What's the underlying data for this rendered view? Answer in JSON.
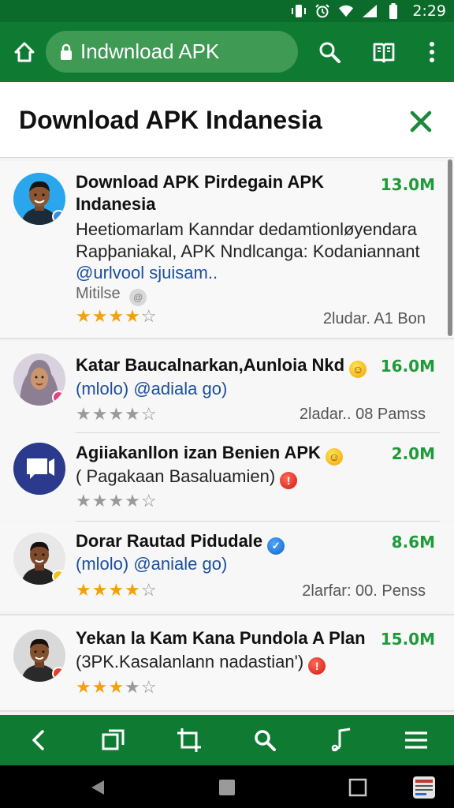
{
  "status_bar": {
    "time": "2:29"
  },
  "browser": {
    "url_text": "Indwnload APK"
  },
  "header": {
    "title": "Download APK Indanesia"
  },
  "apps": [
    {
      "title_line1": "Download APK Pirdegain APK",
      "title_line2": "Indanesia",
      "size": "13.0M",
      "desc_line1": "Heetiomarlam Kanndar dedamtionløyendara",
      "desc_line2": "Rapþaniakal, APK Nndlcanga: Kodaniannant",
      "link": "@urlvool sjuisam..",
      "meta": "Mitilse",
      "rating": 4,
      "info": "2ludar. A1 Bon"
    },
    {
      "title": "Katar Baucalnarkan,Aunloia Nkd",
      "size": "16.0M",
      "subtitle": "(mlolo) @adiala go)",
      "rating": 4,
      "info": "2ladar.. 08 Pamss"
    },
    {
      "title": "Agiiakanllon izan Benien APK",
      "size": "2.0M",
      "subtitle": "( Pagakaan Basaluamien)",
      "rating": 4
    },
    {
      "title": "Dorar Rautad Pidudale",
      "size": "8.6M",
      "subtitle": "(mlolo) @aniale go)",
      "rating": 4,
      "info": "2larfar: 00. Penss"
    },
    {
      "title": "Yekan la Kam Kana Pundola A Plan",
      "size": "15.0M",
      "subtitle": "(3PK.Kasalanlann nadastian')",
      "rating": 3
    }
  ],
  "icons": {
    "toolbar": [
      "home-icon",
      "lock-icon",
      "search-icon",
      "bookmarks-icon",
      "more-vert-icon"
    ],
    "bottom_nav": [
      "back-icon",
      "tabs-icon",
      "crop-icon",
      "search-icon",
      "music-icon",
      "menu-icon"
    ],
    "system_nav": [
      "back-triangle-icon",
      "home-square-icon",
      "recents-square-icon",
      "app-icon"
    ]
  },
  "colors": {
    "brand_green": "#0e7a32",
    "size_green": "#1f9a3a",
    "star_gold": "#f2a10b",
    "link_blue": "#1b4f9c"
  }
}
